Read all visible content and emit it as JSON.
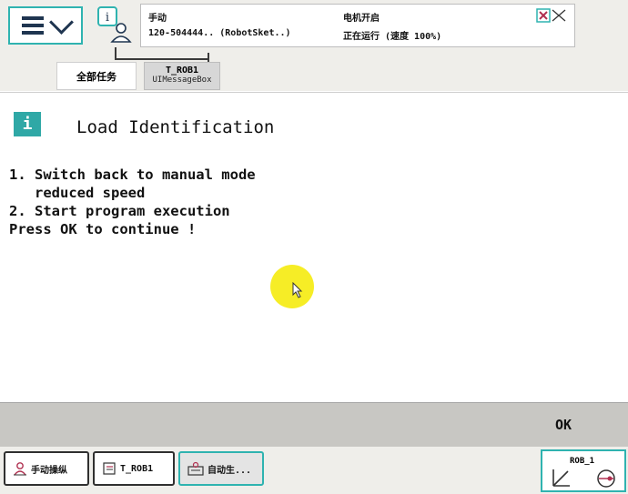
{
  "header": {
    "mode": "手动",
    "controller": "120-504444.. (RobotSket..)",
    "motor": "电机开启",
    "run_status": "正在运行 (速度 100%)"
  },
  "tabs": [
    {
      "label": "全部任务"
    },
    {
      "label": "T_ROB1",
      "sub": "UIMessageBox"
    }
  ],
  "dialog": {
    "info_glyph": "i",
    "title": "Load Identification",
    "lines": [
      "1. Switch back to manual mode",
      "   reduced speed",
      "2. Start program execution",
      "Press OK to continue !"
    ]
  },
  "ok_label": "OK",
  "taskbar": [
    {
      "label": "手动操纵",
      "icon": "user-icon"
    },
    {
      "label": "T_ROB1",
      "icon": "program-icon"
    },
    {
      "label": "自动生...",
      "icon": "production-icon"
    }
  ],
  "quickset": {
    "label": "ROB_1"
  },
  "colors": {
    "accent": "#2fb3b0",
    "info": "#2fa8a6",
    "highlight": "#f5ec1a"
  }
}
